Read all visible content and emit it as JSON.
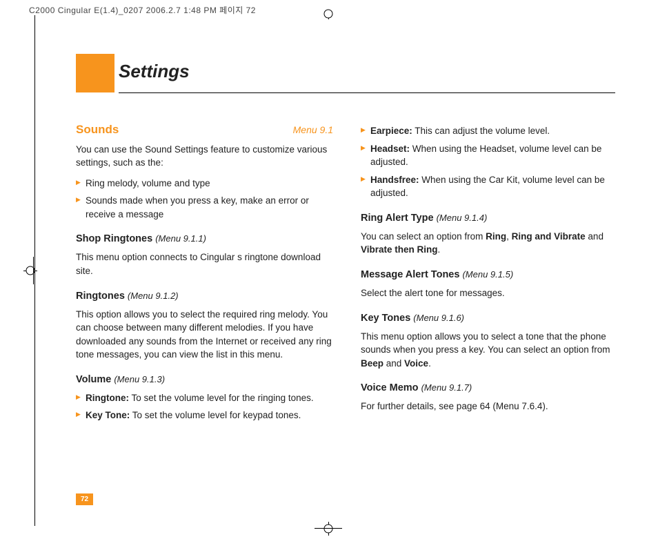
{
  "printers_header": "C2000 Cingular  E(1.4)_0207  2006.2.7 1:48 PM 페이지 72",
  "page_title": "Settings",
  "page_number": "72",
  "sounds": {
    "title": "Sounds",
    "menu_ref": "Menu 9.1",
    "intro": "You can use the Sound Settings feature to customize various settings, such as the:",
    "bullets": [
      "Ring melody, volume and type",
      "Sounds made when you press a key, make an error or receive a message"
    ]
  },
  "shop_ringtones": {
    "title": "Shop Ringtones",
    "menu_ref": "(Menu 9.1.1)",
    "body": "This menu option connects to Cingular s ringtone download site."
  },
  "ringtones": {
    "title": "Ringtones",
    "menu_ref": "(Menu 9.1.2)",
    "body": "This option allows you to select the required ring melody. You can choose between many different melodies. If you have downloaded any sounds from the Internet or received any ring tone messages, you can view the list in this menu."
  },
  "volume": {
    "title": "Volume",
    "menu_ref": "(Menu 9.1.3)",
    "items": [
      {
        "label": "Ringtone:",
        "text": " To set the volume level for the ringing tones."
      },
      {
        "label": "Key Tone:",
        "text": " To set the volume level for keypad tones."
      },
      {
        "label": "Earpiece:",
        "text": " This can adjust the volume level."
      },
      {
        "label": "Headset:",
        "text": " When using the Headset, volume level can be adjusted."
      },
      {
        "label": "Handsfree:",
        "text": " When using the Car Kit, volume level can be adjusted."
      }
    ]
  },
  "ring_alert_type": {
    "title": "Ring Alert Type",
    "menu_ref": "(Menu 9.1.4)",
    "prefix": "You can select an option from ",
    "opt1": "Ring",
    "sep1": ", ",
    "opt2": "Ring and Vibrate",
    "sep2": " and ",
    "opt3": "Vibrate then Ring",
    "suffix": "."
  },
  "message_alert_tones": {
    "title": "Message Alert Tones",
    "menu_ref": "(Menu 9.1.5)",
    "body": "Select the alert tone for messages."
  },
  "key_tones": {
    "title": "Key Tones",
    "menu_ref": "(Menu 9.1.6)",
    "prefix": "This menu option allows you to select a tone that the phone sounds when you press a key. You can select an option from ",
    "opt1": "Beep",
    "sep": " and ",
    "opt2": "Voice",
    "suffix": "."
  },
  "voice_memo": {
    "title": "Voice Memo",
    "menu_ref": "(Menu 9.1.7)",
    "body": "For further details, see page 64 (Menu 7.6.4)."
  }
}
